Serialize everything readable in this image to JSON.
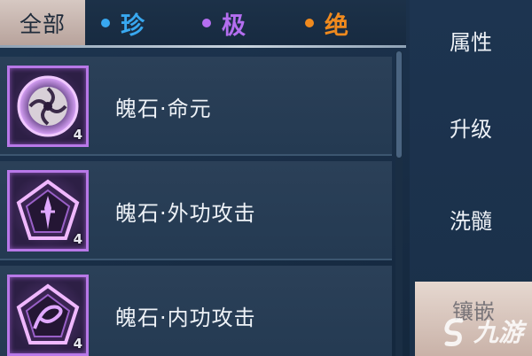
{
  "filters": {
    "all_label": "全部",
    "tabs": [
      {
        "label": "珍",
        "color": "#38a8f0"
      },
      {
        "label": "极",
        "color": "#b46ef0"
      },
      {
        "label": "绝",
        "color": "#f08a1e"
      }
    ]
  },
  "items": [
    {
      "name": "魄石·命元",
      "level": "4",
      "icon": "vortex-icon"
    },
    {
      "name": "魄石·外功攻击",
      "level": "4",
      "icon": "pentagon-sword-icon"
    },
    {
      "name": "魄石·内功攻击",
      "level": "4",
      "icon": "pentagon-swirl-icon"
    }
  ],
  "side_menu": {
    "items": [
      "属性",
      "升级",
      "洗髓",
      "镶嵌"
    ]
  },
  "watermark": {
    "text": "九游"
  },
  "colors": {
    "accent_purple": "#b878e8",
    "selected_tab": "#c9b5ad",
    "background": "#1a2f48"
  }
}
